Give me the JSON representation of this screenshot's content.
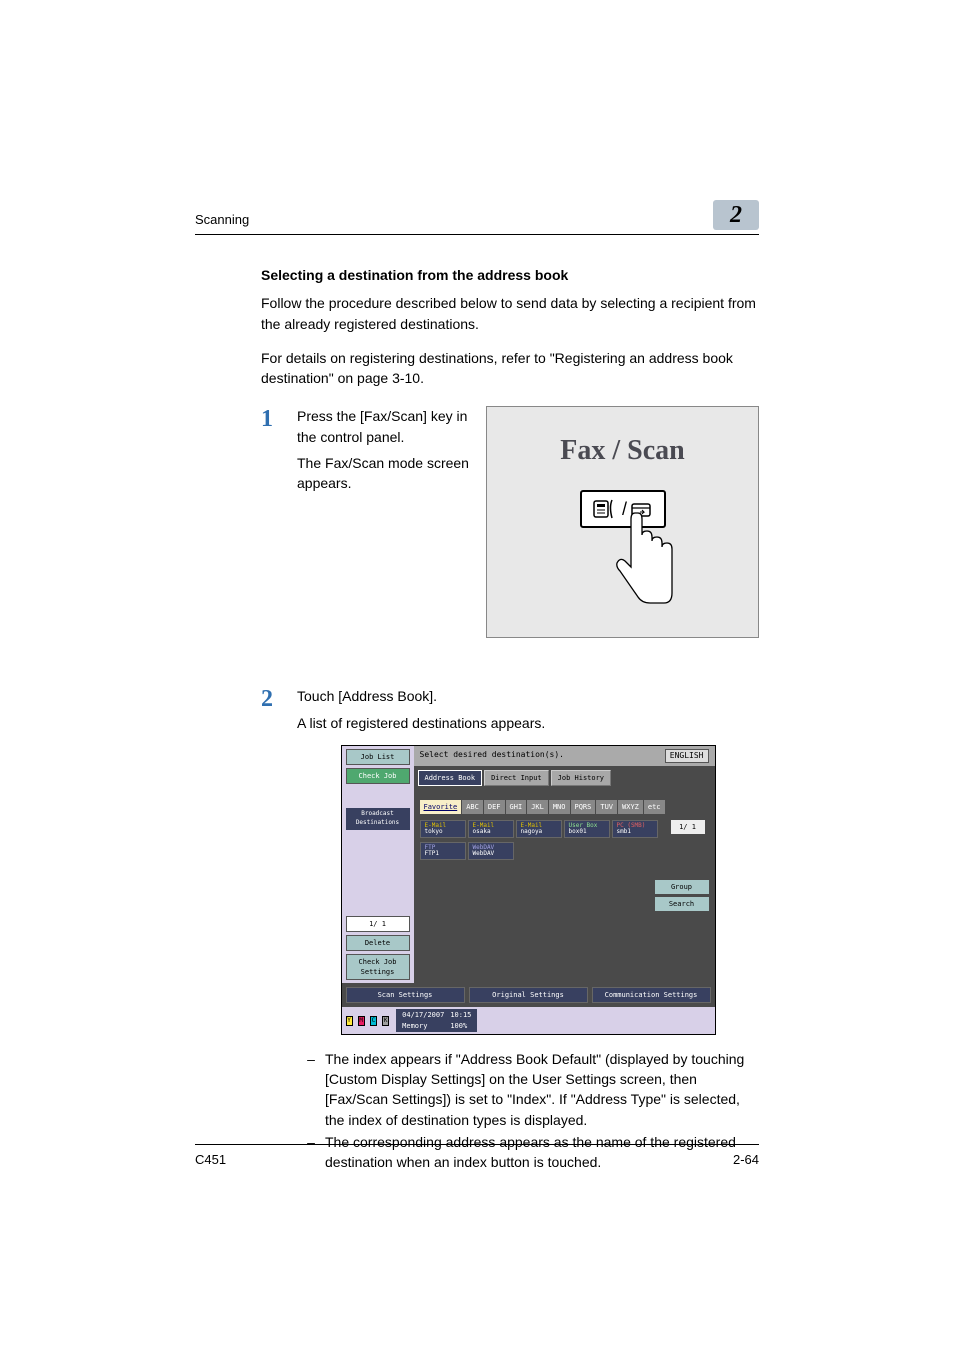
{
  "header": {
    "section": "Scanning",
    "chapter_number": "2"
  },
  "section_title": "Selecting a destination from the address book",
  "intro_para_1": "Follow the procedure described below to send data by selecting a recipient from the already registered destinations.",
  "intro_para_2": "For details on registering destinations, refer to \"Registering an address book destination\" on page 3-10.",
  "step1": {
    "number": "1",
    "line1": "Press the [Fax/Scan] key in the control panel.",
    "line2": "The Fax/Scan mode screen appears.",
    "graphic_label": "Fax / Scan",
    "key_glyph": "☎︎ / ↱"
  },
  "step2": {
    "number": "2",
    "line1": "Touch [Address Book].",
    "line2": "A list of registered destinations appears."
  },
  "screenshot": {
    "title_bar": "Select desired destination(s).",
    "lang_badge": "ENGLISH",
    "left": {
      "job_list": "Job List",
      "check_job": "Check Job",
      "broadcast": "Broadcast Destinations",
      "page": "1/  1",
      "delete": "Delete",
      "check_job_settings": "Check Job Settings"
    },
    "tabs": {
      "address_book": "Address Book",
      "direct_input": "Direct Input",
      "job_history": "Job History"
    },
    "index": [
      "Favorite",
      "ABC",
      "DEF",
      "GHI",
      "JKL",
      "MNO",
      "PQRS",
      "TUV",
      "WXYZ",
      "etc"
    ],
    "destinations_row1": [
      {
        "type": "E-Mail",
        "name": "tokyo",
        "cls": "d1"
      },
      {
        "type": "E-Mail",
        "name": "osaka",
        "cls": "d1"
      },
      {
        "type": "E-Mail",
        "name": "nagoya",
        "cls": "d1"
      },
      {
        "type": "User Box",
        "name": "box01",
        "cls": "d2"
      },
      {
        "type": "PC (SMB)",
        "name": "smb1",
        "cls": "d3"
      }
    ],
    "destinations_row2": [
      {
        "type": "FTP",
        "name": "FTP1",
        "cls": "d4"
      },
      {
        "type": "WebDAV",
        "name": "WebDAV",
        "cls": "d4"
      }
    ],
    "dest_page": "1/  1",
    "side_buttons": {
      "group": "Group",
      "search": "Search"
    },
    "bottom_tabs": {
      "scan_settings": "Scan Settings",
      "original_settings": "Original Settings",
      "communication_settings": "Communication Settings"
    },
    "status": {
      "toners": [
        "Y",
        "M",
        "C",
        "K"
      ],
      "date": "04/17/2007",
      "time": "10:15",
      "memory_label": "Memory",
      "memory_value": "100%"
    }
  },
  "bullets": [
    "The index appears if \"Address Book Default\" (displayed by touching [Custom Display Settings] on the User Settings screen, then [Fax/Scan Settings]) is set to \"Index\". If \"Address Type\" is selected, the index of destination types is displayed.",
    "The corresponding address appears as the name of the registered destination when an index button is touched."
  ],
  "footer": {
    "model": "C451",
    "page": "2-64"
  }
}
